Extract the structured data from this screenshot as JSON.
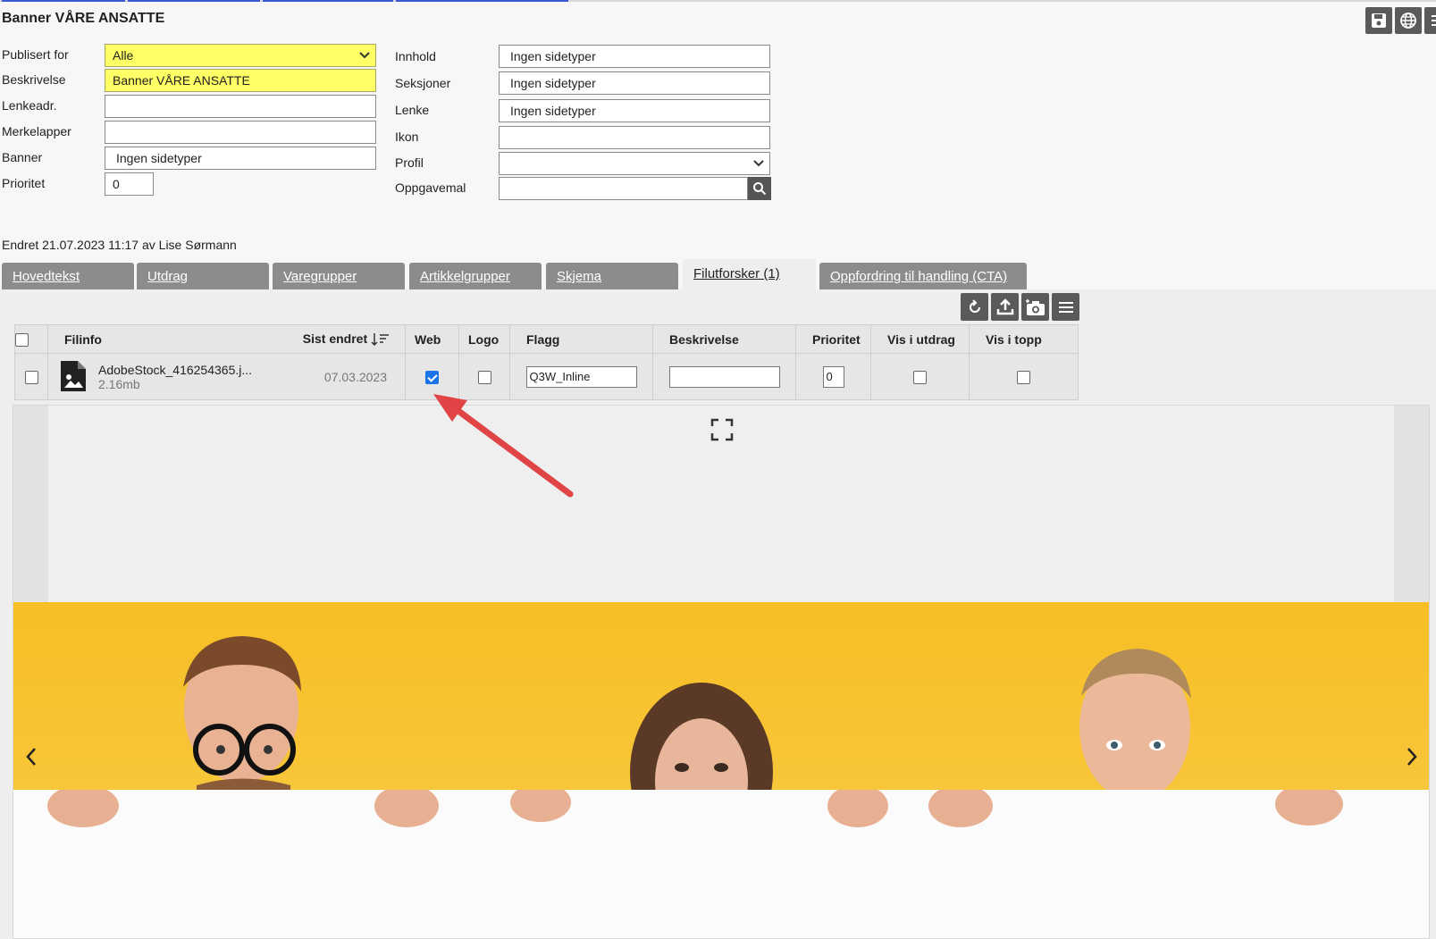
{
  "page": {
    "title": "Banner VÅRE ANSATTE"
  },
  "icons": {
    "top": [
      "save-icon",
      "globe-icon",
      "menu-icon"
    ],
    "toolbar": [
      "refresh-icon",
      "upload-icon",
      "add-photo-icon",
      "menu-icon"
    ]
  },
  "colors": {
    "highlight": "#ffff66",
    "tab_inactive": "#8c8c8c",
    "accent": "#1a73e8",
    "arrow": "#e04444",
    "banner": "#f7be25"
  },
  "form_left": {
    "publisert_label": "Publisert for",
    "publisert_value": "Alle",
    "beskrivelse_label": "Beskrivelse",
    "beskrivelse_value": "Banner VÅRE ANSATTE",
    "lenkeadr_label": "Lenkeadr.",
    "lenkeadr_value": "",
    "merkelapper_label": "Merkelapper",
    "merkelapper_value": "",
    "banner_label": "Banner",
    "banner_value": "Ingen sidetyper",
    "prioritet_label": "Prioritet",
    "prioritet_value": "0"
  },
  "form_right": {
    "innhold_label": "Innhold",
    "innhold_value": "Ingen sidetyper",
    "seksjoner_label": "Seksjoner",
    "seksjoner_value": "Ingen sidetyper",
    "lenke_label": "Lenke",
    "lenke_value": "Ingen sidetyper",
    "ikon_label": "Ikon",
    "ikon_value": "",
    "profil_label": "Profil",
    "profil_value": "",
    "oppgavemal_label": "Oppgavemal",
    "oppgavemal_value": ""
  },
  "changed": "Endret 21.07.2023 11:17 av Lise Sørmann",
  "tabs": [
    {
      "label": "Hovedtekst"
    },
    {
      "label": "Utdrag"
    },
    {
      "label": "Varegrupper"
    },
    {
      "label": "Artikkelgrupper"
    },
    {
      "label": "Skjema"
    },
    {
      "label": "Filutforsker (1)"
    },
    {
      "label": "Oppfordring til handling (CTA)"
    }
  ],
  "table": {
    "headers": {
      "filinfo": "Filinfo",
      "sist_endret": "Sist endret",
      "web": "Web",
      "logo": "Logo",
      "flagg": "Flagg",
      "beskrivelse": "Beskrivelse",
      "prioritet": "Prioritet",
      "vis_utdrag": "Vis i utdrag",
      "vis_topp": "Vis i topp"
    },
    "row": {
      "filename": "AdobeStock_416254365.j...",
      "size": "2.16mb",
      "date": "07.03.2023",
      "web": true,
      "logo": false,
      "flagg": "Q3W_Inline",
      "beskrivelse": "",
      "prioritet": "0",
      "vis_utdrag": false,
      "vis_topp": false
    }
  }
}
